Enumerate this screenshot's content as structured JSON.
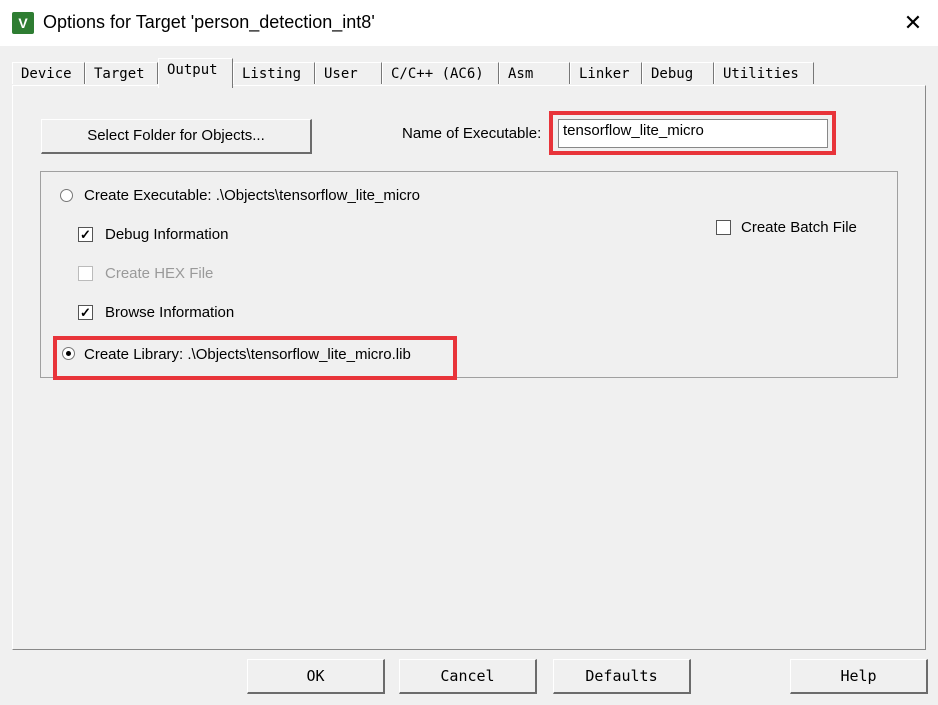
{
  "window": {
    "title": "Options for Target 'person_detection_int8'",
    "app_icon_text": "V",
    "close_glyph": "✕"
  },
  "tabs": [
    {
      "label": "Device",
      "active": false
    },
    {
      "label": "Target",
      "active": false
    },
    {
      "label": "Output",
      "active": true
    },
    {
      "label": "Listing",
      "active": false
    },
    {
      "label": "User",
      "active": false
    },
    {
      "label": "C/C++ (AC6)",
      "active": false
    },
    {
      "label": "Asm",
      "active": false
    },
    {
      "label": "Linker",
      "active": false
    },
    {
      "label": "Debug",
      "active": false
    },
    {
      "label": "Utilities",
      "active": false
    }
  ],
  "output": {
    "select_folder_label": "Select Folder for Objects...",
    "name_of_executable_label": "Name of Executable:",
    "name_of_executable_value": "tensorflow_lite_micro",
    "create_executable_label": "Create Executable:  .\\Objects\\tensorflow_lite_micro",
    "create_executable_selected": false,
    "debug_information_label": "Debug Information",
    "debug_information_checked": true,
    "create_hex_label": "Create HEX File",
    "create_hex_checked": false,
    "create_hex_enabled": false,
    "browse_information_label": "Browse Information",
    "browse_information_checked": true,
    "create_library_label": "Create Library:  .\\Objects\\tensorflow_lite_micro.lib",
    "create_library_selected": true,
    "create_batch_label": "Create Batch File",
    "create_batch_checked": false
  },
  "buttons": {
    "ok": "OK",
    "cancel": "Cancel",
    "defaults": "Defaults",
    "help": "Help"
  },
  "colors": {
    "highlight": "#e8343a",
    "dialog_bg": "#f0f0f0",
    "icon_bg": "#2e7d32"
  }
}
